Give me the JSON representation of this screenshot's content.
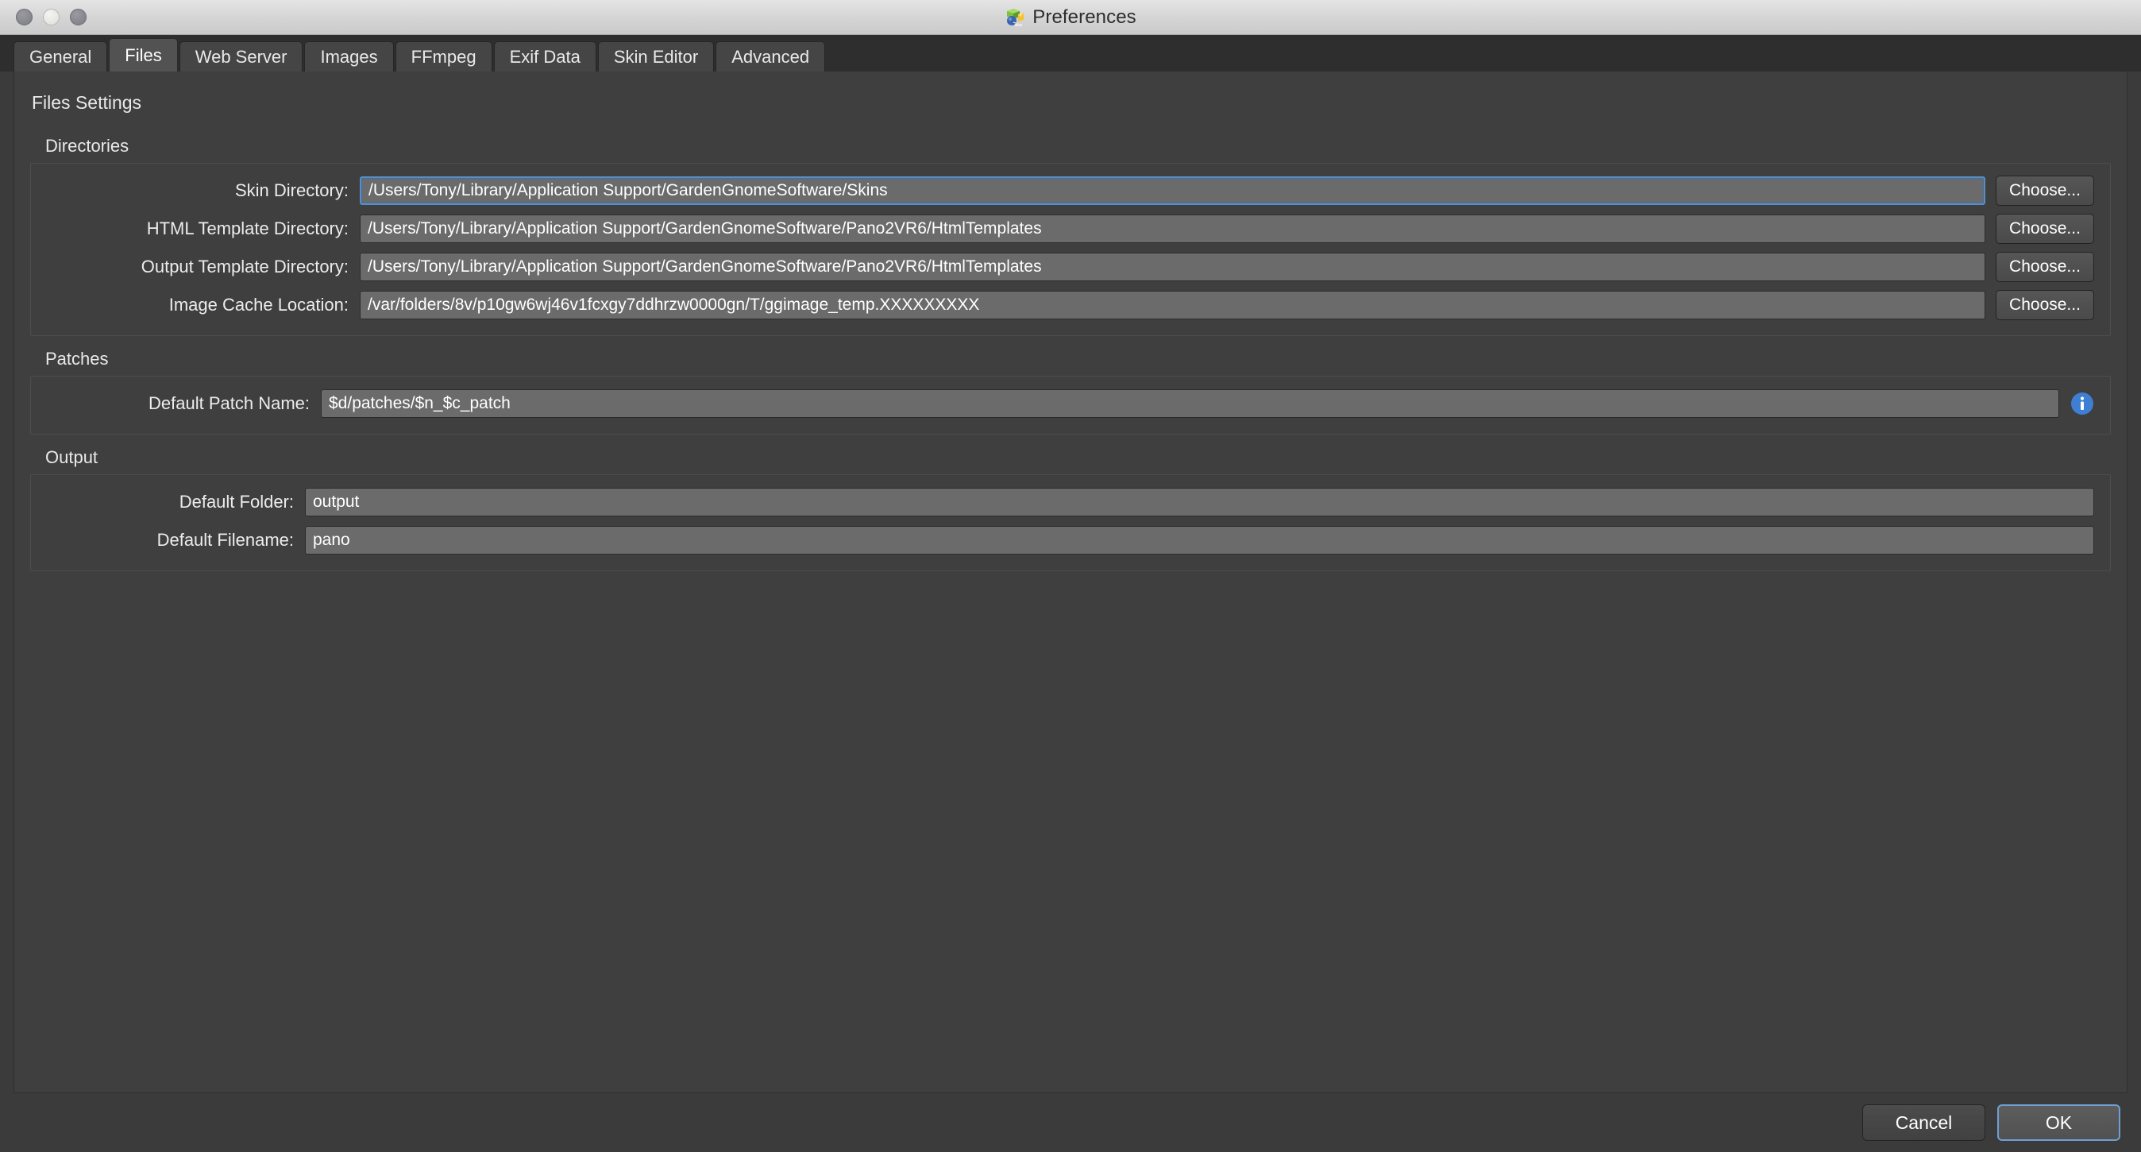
{
  "window": {
    "title": "Preferences",
    "app_icon": "pano2vr-icon",
    "traffic_lights": [
      "close",
      "minimize",
      "maximize"
    ]
  },
  "tabs": [
    {
      "label": "General",
      "active": false
    },
    {
      "label": "Files",
      "active": true
    },
    {
      "label": "Web Server",
      "active": false
    },
    {
      "label": "Images",
      "active": false
    },
    {
      "label": "FFmpeg",
      "active": false
    },
    {
      "label": "Exif Data",
      "active": false
    },
    {
      "label": "Skin Editor",
      "active": false
    },
    {
      "label": "Advanced",
      "active": false
    }
  ],
  "page": {
    "title": "Files Settings"
  },
  "groups": {
    "directories": {
      "label": "Directories",
      "choose_label": "Choose...",
      "rows": [
        {
          "label": "Skin Directory:",
          "value": "/Users/Tony/Library/Application Support/GardenGnomeSoftware/Skins",
          "focused": true
        },
        {
          "label": "HTML Template Directory:",
          "value": "/Users/Tony/Library/Application Support/GardenGnomeSoftware/Pano2VR6/HtmlTemplates",
          "focused": false
        },
        {
          "label": "Output Template Directory:",
          "value": "/Users/Tony/Library/Application Support/GardenGnomeSoftware/Pano2VR6/HtmlTemplates",
          "focused": false
        },
        {
          "label": "Image Cache Location:",
          "value": "/var/folders/8v/p10gw6wj46v1fcxgy7ddhrzw0000gn/T/ggimage_temp.XXXXXXXXX",
          "focused": false
        }
      ]
    },
    "patches": {
      "label": "Patches",
      "row": {
        "label": "Default Patch Name:",
        "value": "$d/patches/$n_$c_patch",
        "info_icon": "info-icon"
      }
    },
    "output": {
      "label": "Output",
      "rows": [
        {
          "label": "Default Folder:",
          "value": "output"
        },
        {
          "label": "Default Filename:",
          "value": "pano"
        }
      ]
    }
  },
  "footer": {
    "cancel_label": "Cancel",
    "ok_label": "OK"
  },
  "colors": {
    "window_bg": "#3b3b3b",
    "content_bg": "#3f3f3f",
    "tabbar_bg": "#2e2e2e",
    "field_bg": "#6b6b6b",
    "accent_focus": "#5a8ec4",
    "info_blue": "#3e7fd4",
    "text": "#ececec"
  }
}
